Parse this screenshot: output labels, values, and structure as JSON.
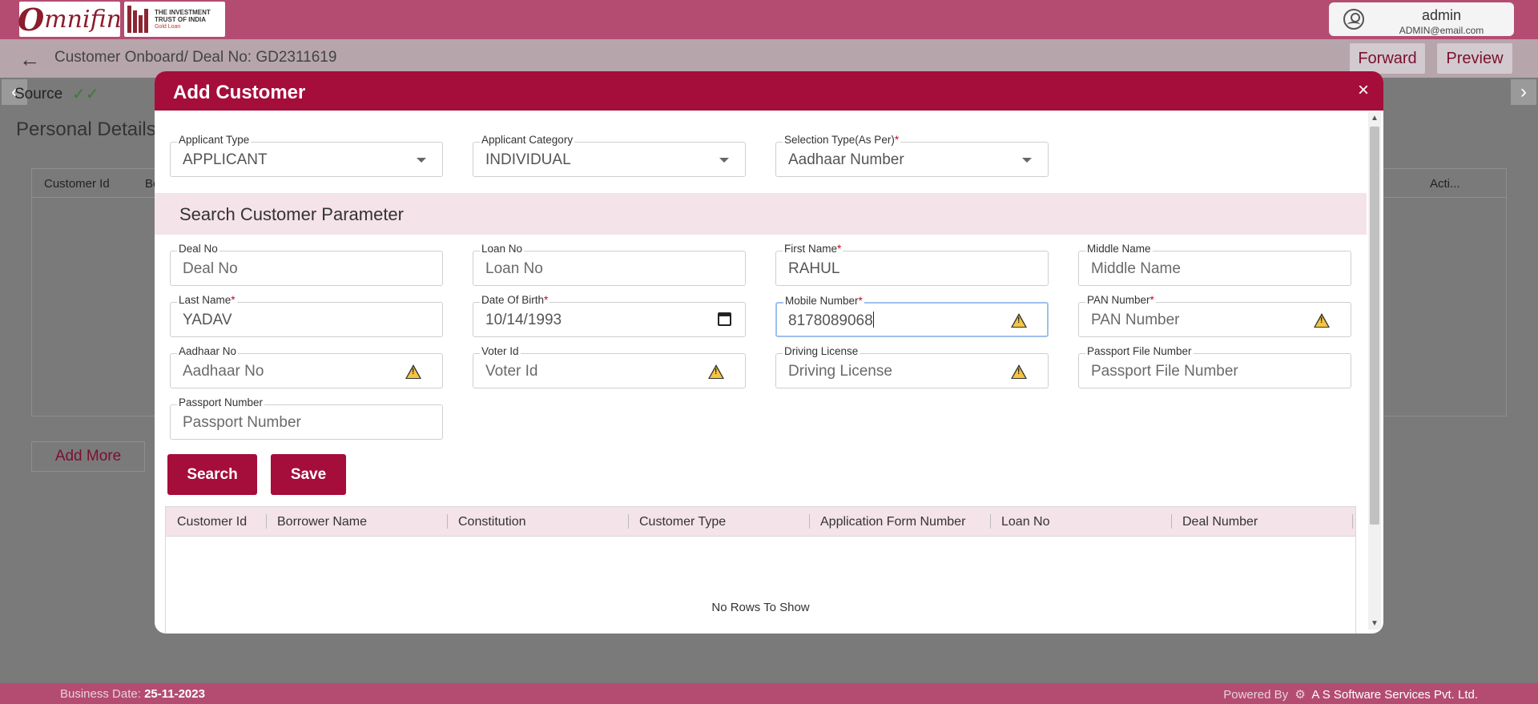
{
  "header": {
    "logo_text_big": "O",
    "logo_text": "mnifin",
    "partner_logo_lines": [
      "THE INVESTMENT",
      "TRUST OF INDIA",
      "Gold Loan"
    ],
    "user_name": "admin",
    "user_email": "ADMIN@email.com"
  },
  "subbar": {
    "back_icon": "←",
    "breadcrumb": "Customer Onboard/  Deal No: GD2311619",
    "forward_label": "Forward",
    "preview_label": "Preview"
  },
  "page": {
    "prev_arrow": "‹",
    "next_arrow": "›",
    "source_label": "Source",
    "source_check": "✓✓",
    "personal_details": "Personal Details",
    "grid_columns": [
      "Customer Id",
      "Bo",
      "Acti..."
    ],
    "add_more_label": "Add More"
  },
  "footer": {
    "business_date_label": "Business Date:",
    "business_date": "25-11-2023",
    "powered_by": "Powered By",
    "company": "A S Software Services Pvt. Ltd."
  },
  "modal": {
    "title": "Add Customer",
    "close_icon": "×",
    "applicant_type": {
      "label": "Applicant Type",
      "value": "APPLICANT"
    },
    "applicant_category": {
      "label": "Applicant Category",
      "value": "INDIVIDUAL"
    },
    "selection_type": {
      "label": "Selection Type(As Per)",
      "required": "*",
      "value": "Aadhaar Number"
    },
    "section_title": "Search Customer Parameter",
    "fields": {
      "deal_no": {
        "label": "Deal No",
        "placeholder": "Deal No"
      },
      "loan_no": {
        "label": "Loan No",
        "placeholder": "Loan No"
      },
      "first_name": {
        "label": "First Name",
        "required": "*",
        "value": "RAHUL"
      },
      "middle_name": {
        "label": "Middle Name",
        "placeholder": "Middle Name"
      },
      "last_name": {
        "label": "Last Name",
        "required": "*",
        "value": "YADAV"
      },
      "date_of_birth": {
        "label": "Date Of Birth",
        "required": "*",
        "value": "10/14/1993"
      },
      "mobile_number": {
        "label": "Mobile Number",
        "required": "*",
        "value": "8178089068"
      },
      "pan_number": {
        "label": "PAN Number",
        "required": "*",
        "placeholder": "PAN Number"
      },
      "aadhaar_no": {
        "label": "Aadhaar No",
        "placeholder": "Aadhaar No"
      },
      "voter_id": {
        "label": "Voter Id",
        "placeholder": "Voter Id"
      },
      "driving_license": {
        "label": "Driving License",
        "placeholder": "Driving License"
      },
      "passport_file_number": {
        "label": "Passport File Number",
        "placeholder": "Passport File Number"
      },
      "passport_number": {
        "label": "Passport Number",
        "placeholder": "Passport Number"
      }
    },
    "search_label": "Search",
    "save_label": "Save",
    "results": {
      "columns": [
        "Customer Id",
        "Borrower Name",
        "Constitution",
        "Customer Type",
        "Application Form Number",
        "Loan No",
        "Deal Number"
      ],
      "empty_text": "No Rows To Show"
    }
  },
  "colors": {
    "brand": "#a50d3b",
    "topbar": "#b44c72",
    "section_band": "#f4e3e9"
  }
}
